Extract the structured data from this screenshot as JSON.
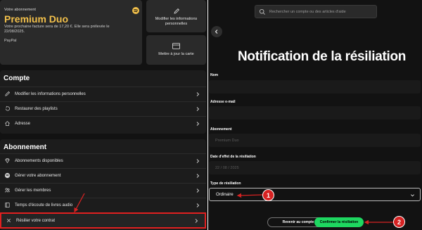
{
  "left": {
    "plan": {
      "kicker": "Votre abonnement",
      "name": "Premium Duo",
      "description": "Votre prochaine facture sera de 17,20 €. Elle sera prélevée le 22/08/2025.",
      "payment_method": "PayPal"
    },
    "quick_actions": {
      "edit_info": "Modifier les informations personnelles",
      "update_card": "Mettre à jour la carte"
    },
    "account": {
      "title": "Compte",
      "items": [
        {
          "label": "Modifier les informations personnelles",
          "icon": "pencil-icon"
        },
        {
          "label": "Restaurer des playlists",
          "icon": "restore-icon"
        },
        {
          "label": "Adresse",
          "icon": "home-icon"
        }
      ]
    },
    "subscription": {
      "title": "Abonnement",
      "items": [
        {
          "label": "Abonnements disponibles",
          "icon": "diamond-icon"
        },
        {
          "label": "Gérer votre abonnement",
          "icon": "spotify-icon"
        },
        {
          "label": "Gérer les membres",
          "icon": "members-icon"
        },
        {
          "label": "Temps d'écoute de livres audio",
          "icon": "book-icon"
        },
        {
          "label": "Résilier votre contrat",
          "icon": "close-icon"
        }
      ]
    }
  },
  "right": {
    "search_placeholder": "Rechercher un compte ou des articles d'aide",
    "title": "Notification de la résiliation",
    "fields": [
      {
        "label": "Nom",
        "value": ""
      },
      {
        "label": "Adresse e-mail",
        "value": ""
      },
      {
        "label": "Abonnement",
        "value": "Premium Duo"
      },
      {
        "label": "Date d'effet de la résiliation",
        "value": "22 / 08 / 2025"
      }
    ],
    "type_field": {
      "label": "Type de résiliation",
      "value": "Ordinaire"
    },
    "buttons": {
      "back": "Revenir au compte",
      "confirm": "Confirmer la résiliation"
    }
  },
  "annotations": {
    "badge_1": "1",
    "badge_2": "2"
  },
  "colors": {
    "accent_gold": "#f2c04b",
    "accent_green": "#1ed760",
    "annotation_red": "#d62222",
    "background": "#121212"
  }
}
